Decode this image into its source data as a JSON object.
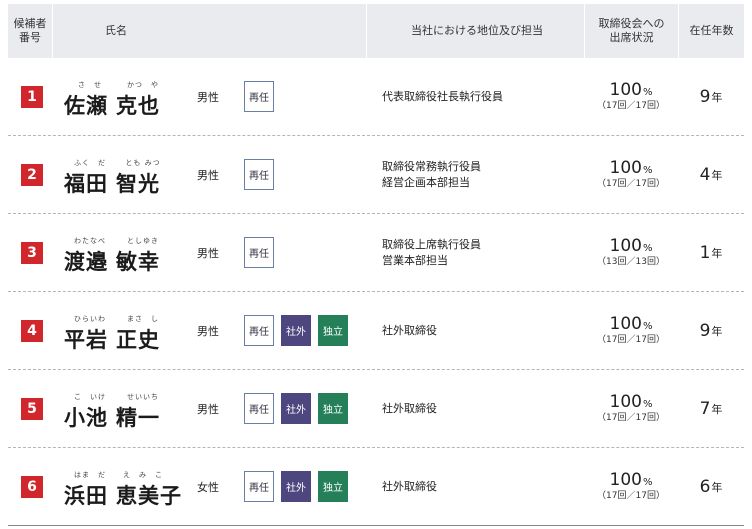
{
  "header": {
    "no_line1": "候補者",
    "no_line2": "番号",
    "name": "氏名",
    "position": "当社における地位及び担当",
    "attendance_line1": "取締役会への",
    "attendance_line2": "出席状況",
    "tenure": "在任年数"
  },
  "labels": {
    "reelect": "再任",
    "outside": "社外",
    "independent": "独立",
    "tenure_unit": "年",
    "percent_unit": "%"
  },
  "candidates": [
    {
      "no": "1",
      "furigana_family": "さ　せ",
      "furigana_given": "かつ　や",
      "family": "佐瀬",
      "given": "克也",
      "gender": "男性",
      "position_1": "代表取締役社長執行役員",
      "position_2": "",
      "attendance": "100",
      "attendance_detail": "（17回／17回）",
      "tenure": "9"
    },
    {
      "no": "2",
      "furigana_family": "ふく　だ",
      "furigana_given": "とも みつ",
      "family": "福田",
      "given": "智光",
      "gender": "男性",
      "position_1": "取締役常務執行役員",
      "position_2": "経営企画本部担当",
      "attendance": "100",
      "attendance_detail": "（17回／17回）",
      "tenure": "4"
    },
    {
      "no": "3",
      "furigana_family": "わたなべ",
      "furigana_given": "としゆき",
      "family": "渡邉",
      "given": "敏幸",
      "gender": "男性",
      "position_1": "取締役上席執行役員",
      "position_2": "営業本部担当",
      "attendance": "100",
      "attendance_detail": "（13回／13回）",
      "tenure": "1"
    },
    {
      "no": "4",
      "furigana_family": "ひらいわ",
      "furigana_given": "まさ　し",
      "family": "平岩",
      "given": "正史",
      "gender": "男性",
      "position_1": "社外取締役",
      "position_2": "",
      "attendance": "100",
      "attendance_detail": "（17回／17回）",
      "tenure": "9"
    },
    {
      "no": "5",
      "furigana_family": "こ　いけ",
      "furigana_given": "せいいち",
      "family": "小池",
      "given": "精一",
      "gender": "男性",
      "position_1": "社外取締役",
      "position_2": "",
      "attendance": "100",
      "attendance_detail": "（17回／17回）",
      "tenure": "7"
    },
    {
      "no": "6",
      "furigana_family": "はま　だ",
      "furigana_given": "え　み　こ",
      "family": "浜田",
      "given": "恵美子",
      "gender": "女性",
      "position_1": "社外取締役",
      "position_2": "",
      "attendance": "100",
      "attendance_detail": "（17回／17回）",
      "tenure": "6"
    }
  ],
  "colors": {
    "badge": "#d0262c",
    "outside_tag": "#4e467e",
    "independent_tag": "#25805a",
    "header_bg": "#e9ebee"
  }
}
